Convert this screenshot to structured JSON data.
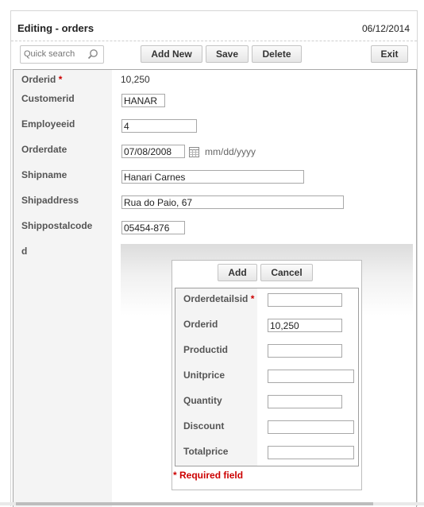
{
  "header": {
    "title": "Editing - orders",
    "date": "06/12/2014"
  },
  "search": {
    "placeholder": "Quick search"
  },
  "toolbar": {
    "add_new": "Add New",
    "save": "Save",
    "delete": "Delete",
    "exit": "Exit"
  },
  "form": {
    "orderid": {
      "label": "Orderid",
      "required": "*",
      "value": "10,250"
    },
    "customerid": {
      "label": "Customerid",
      "value": "HANAR"
    },
    "employeeid": {
      "label": "Employeeid",
      "value": "4"
    },
    "orderdate": {
      "label": "Orderdate",
      "value": "07/08/2008",
      "hint": "mm/dd/yyyy"
    },
    "shipname": {
      "label": "Shipname",
      "value": "Hanari Carnes"
    },
    "shipaddress": {
      "label": "Shipaddress",
      "value": "Rua do Paio, 67"
    },
    "shippostalcode": {
      "label": "Shippostalcode",
      "value": "05454-876"
    },
    "d": {
      "label": "d"
    }
  },
  "subform": {
    "add": "Add",
    "cancel": "Cancel",
    "orderdetailsid": {
      "label": "Orderdetailsid",
      "required": "*",
      "value": ""
    },
    "orderid": {
      "label": "Orderid",
      "value": "10,250"
    },
    "productid": {
      "label": "Productid",
      "value": ""
    },
    "unitprice": {
      "label": "Unitprice",
      "value": ""
    },
    "quantity": {
      "label": "Quantity",
      "value": ""
    },
    "discount": {
      "label": "Discount",
      "value": ""
    },
    "totalprice": {
      "label": "Totalprice",
      "value": ""
    },
    "required_asterisk": "*",
    "required_note": "Required field"
  },
  "colors": {
    "required": "#cc0000",
    "label_bg": "#f4f4f4",
    "border": "#a9a9a9"
  },
  "icons": {
    "search": "magnifier-icon",
    "calendar": "calendar-icon"
  }
}
